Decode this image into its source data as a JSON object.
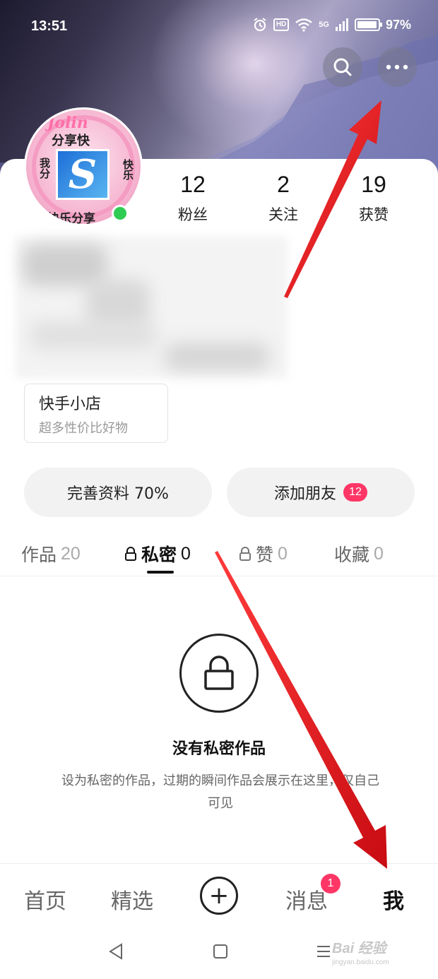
{
  "status_bar": {
    "time": "13:51",
    "network": "5G",
    "hd": "HD",
    "battery": "97%"
  },
  "header_actions": {
    "search_icon": "search-icon",
    "more_icon": "more-dots-icon"
  },
  "profile": {
    "avatar_texts": {
      "brand": "Jolin",
      "top": "分享快",
      "left": "我分",
      "right": "快乐",
      "bottom": "快乐分享",
      "logo_letter": "S"
    },
    "online": true,
    "stats": [
      {
        "value": "12",
        "label": "粉丝"
      },
      {
        "value": "2",
        "label": "关注"
      },
      {
        "value": "19",
        "label": "获赞"
      }
    ]
  },
  "shop": {
    "title": "快手小店",
    "subtitle": "超多性价比好物"
  },
  "actions": {
    "complete_profile": "完善资料 70%",
    "add_friends": "添加朋友",
    "add_friends_badge": "12"
  },
  "tabs": [
    {
      "label": "作品",
      "count": "20",
      "locked": false,
      "active": false
    },
    {
      "label": "私密",
      "count": "0",
      "locked": true,
      "active": true
    },
    {
      "label": "赞",
      "count": "0",
      "locked": true,
      "active": false
    },
    {
      "label": "收藏",
      "count": "0",
      "locked": false,
      "active": false
    }
  ],
  "empty_state": {
    "title": "没有私密作品",
    "description": "设为私密的作品，过期的瞬间作品会展示在这里，仅自己可见"
  },
  "bottom_nav": {
    "home": "首页",
    "featured": "精选",
    "create": "+",
    "messages": "消息",
    "messages_badge": "1",
    "me": "我"
  },
  "watermark": {
    "text": "Bai 经验",
    "sub": "jingyan.baidu.com"
  },
  "colors": {
    "accent_red": "#fe3666",
    "online_green": "#2ecc52",
    "annotation_arrow": "#e8141a"
  }
}
